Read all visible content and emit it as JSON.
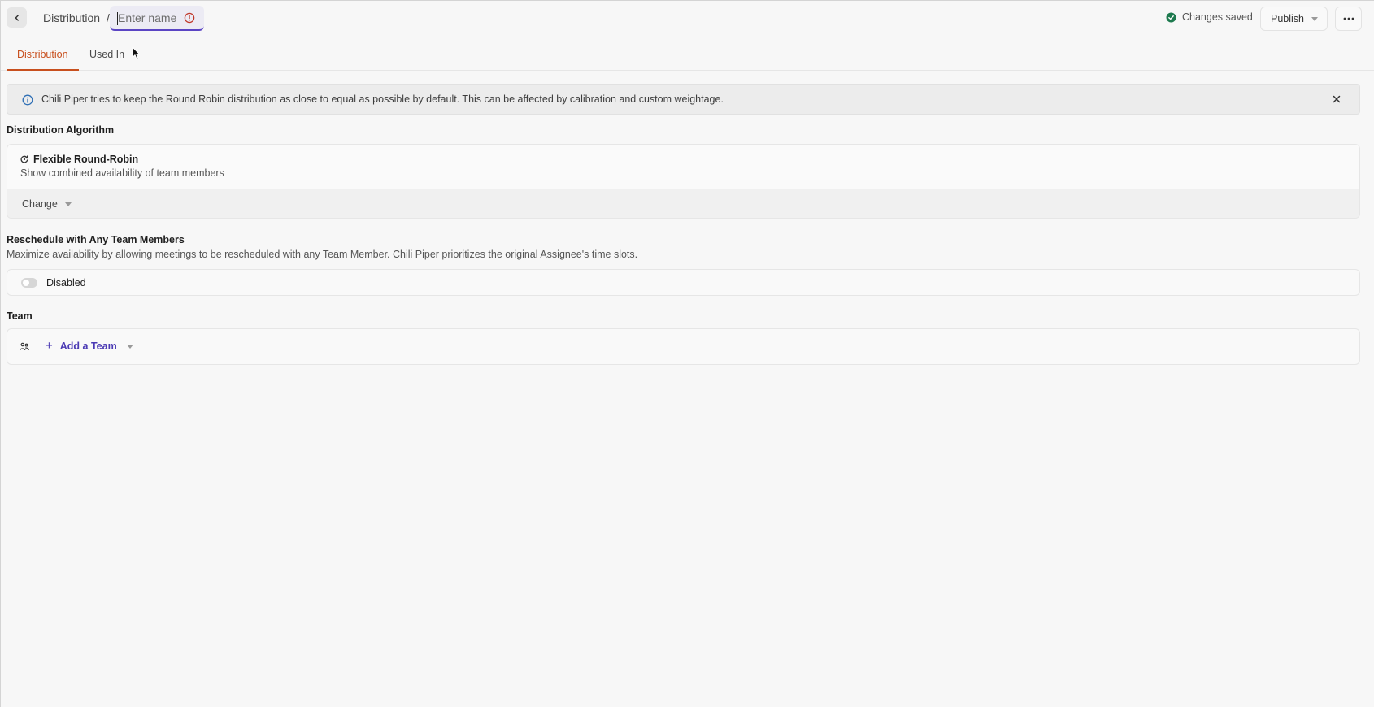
{
  "header": {
    "breadcrumb_root": "Distribution",
    "breadcrumb_separator": "/",
    "name_input": {
      "value": "",
      "placeholder": "Enter name"
    },
    "status_text": "Changes saved",
    "publish_label": "Publish"
  },
  "tabs": [
    {
      "label": "Distribution",
      "active": true
    },
    {
      "label": "Used In",
      "active": false
    }
  ],
  "banner": {
    "text": "Chili Piper tries to keep the Round Robin distribution as close to equal as possible by default. This can be affected by calibration and custom weightage."
  },
  "algorithm": {
    "section_title": "Distribution Algorithm",
    "name": "Flexible Round-Robin",
    "description": "Show combined availability of team members",
    "change_label": "Change"
  },
  "reschedule": {
    "section_title": "Reschedule with Any Team Members",
    "description": "Maximize availability by allowing meetings to be rescheduled with any Team Member. Chili Piper prioritizes the original Assignee's time slots.",
    "toggle_label": "Disabled",
    "enabled": false
  },
  "team": {
    "section_title": "Team",
    "add_label": "Add a Team"
  },
  "colors": {
    "accent_tab": "#c8501e",
    "primary": "#4b3ab4",
    "success": "#1e7a4f",
    "error": "#c0392b",
    "info": "#2f6fb5"
  }
}
